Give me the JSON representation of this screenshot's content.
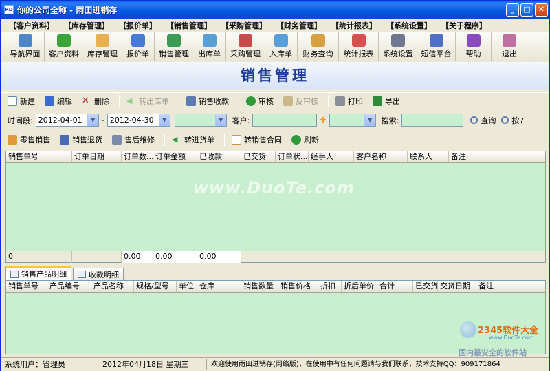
{
  "window": {
    "title": "你的公司全称 - 雨田进销存",
    "app_icon_text": "RD",
    "min_label": "_",
    "max_label": "□",
    "close_label": "✕"
  },
  "menu": [
    "【客户资料】",
    "【库存管理】",
    "【报价单】",
    "【销售管理】",
    "【采购管理】",
    "【财务管理】",
    "【统计报表】",
    "【系统设置】",
    "【关于程序】"
  ],
  "toolbar": [
    {
      "label": "导航界面",
      "icon": "navigation-icon",
      "color": "#4e87c8"
    },
    {
      "label": "客户资料",
      "icon": "customers-icon",
      "color": "#3aa33a"
    },
    {
      "label": "库存管理",
      "icon": "warehouse-icon",
      "color": "#e9b050"
    },
    {
      "label": "报价单",
      "icon": "quote-icon",
      "color": "#4a7ad8"
    },
    {
      "label": "销售管理",
      "icon": "sales-icon",
      "color": "#3c9b54"
    },
    {
      "label": "出库单",
      "icon": "outbound-icon",
      "color": "#5aa0d8"
    },
    {
      "label": "采购管理",
      "icon": "purchase-icon",
      "color": "#c84a4a"
    },
    {
      "label": "入库单",
      "icon": "inbound-icon",
      "color": "#5aa0d8"
    },
    {
      "label": "财务查询",
      "icon": "finance-icon",
      "color": "#d8a040"
    },
    {
      "label": "统计报表",
      "icon": "report-icon",
      "color": "#d85050"
    },
    {
      "label": "系统设置",
      "icon": "settings-icon",
      "color": "#707890"
    },
    {
      "label": "短信平台",
      "icon": "sms-icon",
      "color": "#5070c8"
    },
    {
      "label": "帮助",
      "icon": "help-icon",
      "color": "#8a4ac0"
    },
    {
      "label": "退出",
      "icon": "exit-icon",
      "color": "#c070a0"
    }
  ],
  "banner_title": "销售管理",
  "actions": {
    "new": "新建",
    "edit": "编辑",
    "delete": "删除",
    "to_outbound": "转出库单",
    "collect": "销售收款",
    "approve": "审核",
    "unapprove": "反审核",
    "print": "打印",
    "export": "导出"
  },
  "filter": {
    "period_label": "时间段:",
    "date_from": "2012-04-01",
    "date_to": "2012-04-30",
    "dash": "-",
    "customer_label": "客户:",
    "search_label": "搜索:",
    "query": "查询",
    "query2": "按7"
  },
  "actions2": {
    "retail": "零售销售",
    "return": "销售退货",
    "after_sales": "售后维修",
    "to_purchase": "转进货单",
    "to_contract": "转销售合同",
    "refresh": "刷新"
  },
  "grid1": {
    "columns": [
      "销售单号",
      "订单日期",
      "订单数...",
      "订单金额",
      "已收款",
      "已交货",
      "订单状...",
      "经手人",
      "客户名称",
      "联系人",
      "备注"
    ],
    "footer": [
      "0",
      "",
      "0.00",
      "0.00",
      "0.00"
    ]
  },
  "watermark": "www.DuoTe.com",
  "tabs": [
    "销售产品明细",
    "收款明细"
  ],
  "grid2": {
    "columns": [
      "销售单号",
      "产品编号",
      "产品名称",
      "规格/型号",
      "单位",
      "仓库",
      "销售数量",
      "销售价格",
      "折扣",
      "折后单价",
      "合计",
      "已交货",
      "交货日期",
      "备注"
    ]
  },
  "status": {
    "user": "系统用户：管理员",
    "date": "2012年04月18日 星期三",
    "message": "欢迎使用雨田进销存(网络版)，在使用中有任何问题请与我们联系，技术支持QQ：909171864"
  },
  "logo": {
    "title": "2345软件大全",
    "url": "www.DuoTe.com",
    "tagline": "国内最安全的软件站"
  }
}
